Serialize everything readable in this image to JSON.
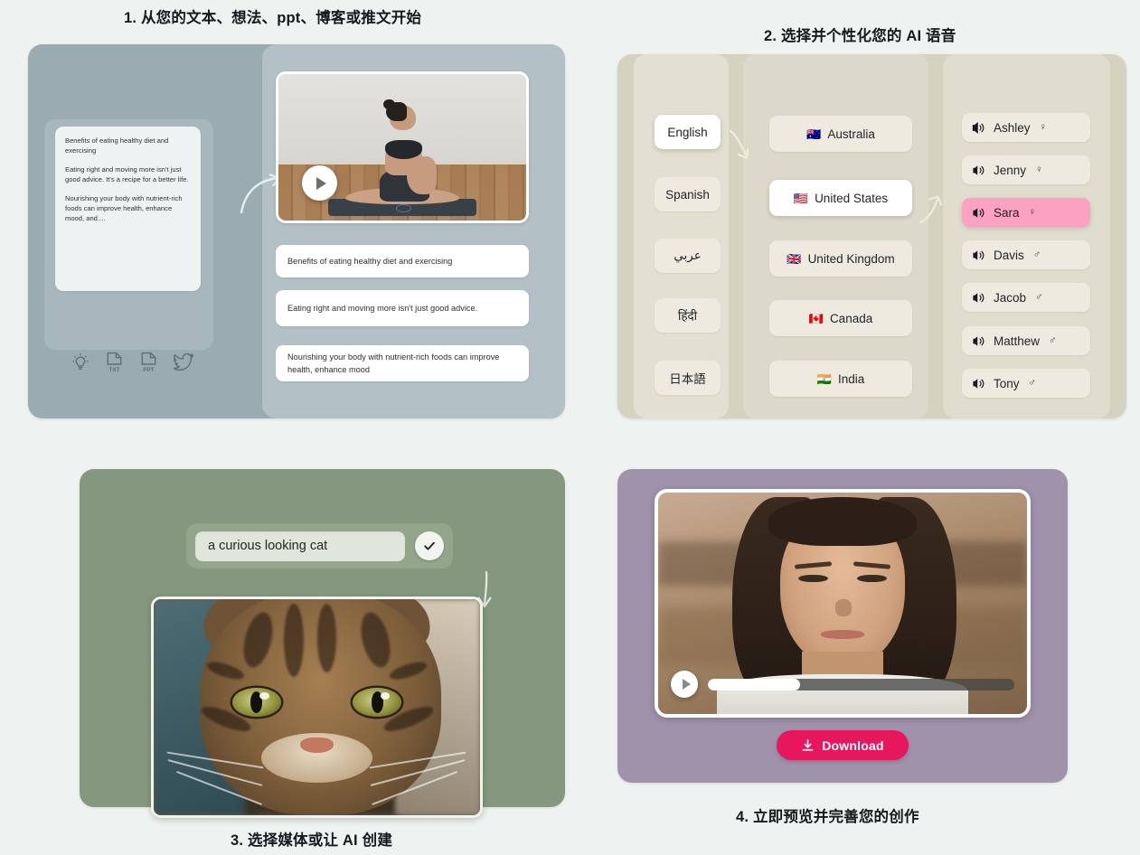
{
  "captions": {
    "step1": "1. 从您的文本、想法、ppt、博客或推文开始",
    "step2": "2. 选择并个性化您的 AI 语音",
    "step3": "3. 选择媒体或让 AI 创建",
    "step4": "4. 立即预览并完善您的创作"
  },
  "panel1": {
    "source_text": [
      "Benefits of eating healthy diet and exercising",
      "Eating right and moving more isn't just good advice. It's a recipe for a better life.",
      "Nourishing your body with nutrient-rich foods can improve health, enhance mood, and...."
    ],
    "input_icons": [
      {
        "name": "idea-lightbulb-icon",
        "label": ""
      },
      {
        "name": "txt-file-icon",
        "label": "TXT"
      },
      {
        "name": "ppt-file-icon",
        "label": "PPT"
      },
      {
        "name": "twitter-bird-icon",
        "label": ""
      }
    ],
    "video_alt": "woman meditating in lotus pose on a yoga mat",
    "scene_rows": [
      "Benefits of eating healthy diet and exercising",
      "Eating right and moving more isn't just good advice.",
      "Nourishing your body with nutrient-rich foods can improve health, enhance mood"
    ]
  },
  "panel2": {
    "languages": [
      {
        "label": "English",
        "selected": true
      },
      {
        "label": "Spanish",
        "selected": false
      },
      {
        "label": "عربي",
        "selected": false
      },
      {
        "label": "हिंदी",
        "selected": false
      },
      {
        "label": "日本語",
        "selected": false
      }
    ],
    "countries": [
      {
        "label": "Australia",
        "flag": "🇦🇺",
        "selected": false
      },
      {
        "label": "United States",
        "flag": "🇺🇸",
        "selected": true
      },
      {
        "label": "United Kingdom",
        "flag": "🇬🇧",
        "selected": false
      },
      {
        "label": "Canada",
        "flag": "🇨🇦",
        "selected": false
      },
      {
        "label": "India",
        "flag": "🇮🇳",
        "selected": false
      }
    ],
    "voices": [
      {
        "label": "Ashley",
        "gender": "♀",
        "selected": false
      },
      {
        "label": "Jenny",
        "gender": "♀",
        "selected": false
      },
      {
        "label": "Sara",
        "gender": "♀",
        "selected": true
      },
      {
        "label": "Davis",
        "gender": "♂",
        "selected": false
      },
      {
        "label": "Jacob",
        "gender": "♂",
        "selected": false
      },
      {
        "label": "Matthew",
        "gender": "♂",
        "selected": false
      },
      {
        "label": "Tony",
        "gender": "♂",
        "selected": false
      }
    ]
  },
  "panel3": {
    "prompt_value": "a curious looking cat",
    "confirm_icon": "check-icon",
    "image_alt": "close-up portrait of a tabby cat"
  },
  "panel4": {
    "video_alt": "smiling woman presenter talking to camera",
    "progress_percent": 30,
    "download_label": "Download"
  },
  "colors": {
    "page_background": "#eef2f1",
    "panel1": "#9aabb2",
    "panel1_inner": "#b3c1c6",
    "panel2": "#d6d2c0",
    "panel2_column": "#e3dfd1",
    "panel3": "#85987f",
    "panel4": "#a092ab",
    "voice_selected": "#fba1c2",
    "download_button": "#e8175d",
    "text": "#1d2326"
  }
}
